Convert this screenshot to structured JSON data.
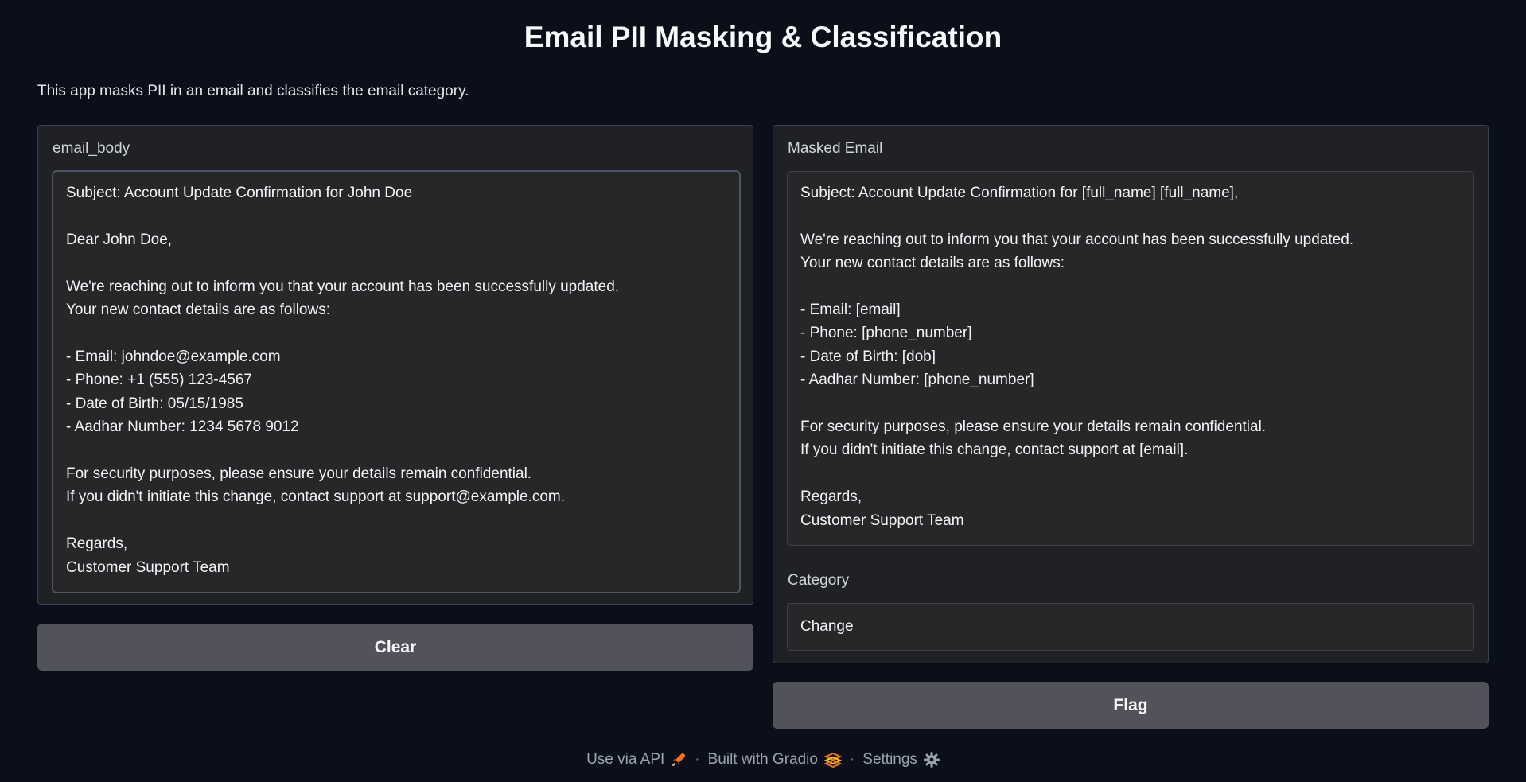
{
  "title": "Email PII Masking & Classification",
  "description": "This app masks PII in an email and classifies the email category.",
  "input": {
    "label": "email_body",
    "value": "Subject: Account Update Confirmation for John Doe\n\nDear John Doe,\n\nWe're reaching out to inform you that your account has been successfully updated.\nYour new contact details are as follows:\n\n- Email: johndoe@example.com\n- Phone: +1 (555) 123-4567\n- Date of Birth: 05/15/1985\n- Aadhar Number: 1234 5678 9012\n\nFor security purposes, please ensure your details remain confidential.\nIf you didn't initiate this change, contact support at support@example.com.\n\nRegards,\nCustomer Support Team"
  },
  "output": {
    "masked_label": "Masked Email",
    "masked_value": "Subject: Account Update Confirmation for [full_name] [full_name],\n\nWe're reaching out to inform you that your account has been successfully updated.\nYour new contact details are as follows:\n\n- Email: [email]\n- Phone: [phone_number]\n- Date of Birth: [dob]\n- Aadhar Number: [phone_number]\n\nFor security purposes, please ensure your details remain confidential.\nIf you didn't initiate this change, contact support at [email].\n\nRegards,\nCustomer Support Team",
    "category_label": "Category",
    "category_value": "Change"
  },
  "buttons": {
    "clear": "Clear",
    "flag": "Flag"
  },
  "footer": {
    "api": "Use via API",
    "built": "Built with Gradio",
    "settings": "Settings",
    "separator": "·",
    "icons": [
      "rocket-icon",
      "gradio-logo-icon",
      "gear-icon"
    ]
  },
  "colors": {
    "background": "#0b0f19",
    "panel": "#202124",
    "button": "#52525b",
    "accent": "#f97316"
  }
}
